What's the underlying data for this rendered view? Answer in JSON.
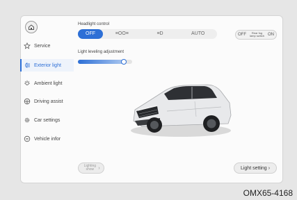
{
  "sidebar": {
    "home_icon": "home-icon",
    "items": [
      {
        "label": "Service",
        "icon": "star-icon"
      },
      {
        "label": "Exterior light",
        "icon": "headlight-icon",
        "active": true
      },
      {
        "label": "Ambient light",
        "icon": "bulb-icon"
      },
      {
        "label": "Driving assist",
        "icon": "steering-wheel-icon"
      },
      {
        "label": "Car settings",
        "icon": "gear-icon"
      },
      {
        "label": "Vehicle infor",
        "icon": "info-icon"
      }
    ]
  },
  "headlight": {
    "title": "Headlight control",
    "options": [
      "OFF",
      "≡OO≡",
      "≡D",
      "AUTO"
    ],
    "selected": "OFF"
  },
  "rear_fog": {
    "off_label": "OFF",
    "title": "Rear fog lamp switch",
    "on_label": "ON"
  },
  "leveling": {
    "label": "Light leveling adjustment",
    "level": 0.85
  },
  "buttons": {
    "lighting_show": "Lighting show",
    "light_setting": "Light setting"
  },
  "figure_code": "OMX65-4168",
  "colors": {
    "accent": "#2d6fd6",
    "panel": "#fbfbfb",
    "background": "#e6e6e6"
  }
}
